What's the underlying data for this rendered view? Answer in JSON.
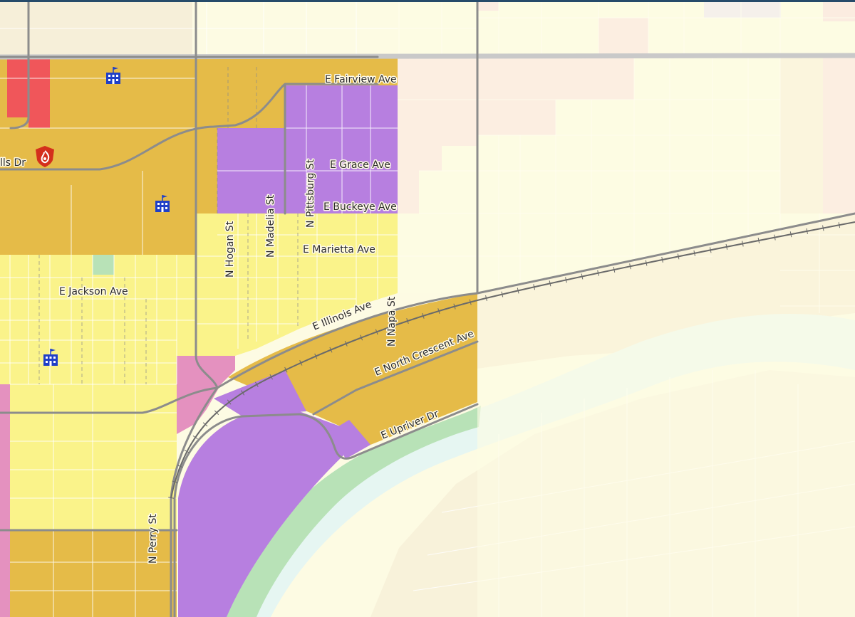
{
  "map": {
    "colors": {
      "background": "#fdfbe3",
      "mixed_use": "#e5bb48",
      "residential_single": "#faf38a",
      "institutional": "#b77fe0",
      "commercial_light": "#f5a6b6",
      "commercial_pink": "#e491bf",
      "commercial_red": "#f0565a",
      "park": "#b8e2b7",
      "river": "#e6f6f2",
      "light_industrial": "#f3e3c3",
      "school_icon": "#1f3fc7",
      "fire_icon": "#d42f1c",
      "top_border": "#264b6a"
    },
    "streets": {
      "fairview": "E Fairview Ave",
      "grace": "E Grace Ave",
      "buckeye": "E Buckeye Ave",
      "marietta": "E Marietta Ave",
      "jackson": "E Jackson Ave",
      "illinois": "E Illinois Ave",
      "north_crescent": "E North Crescent Ave",
      "upriver": "E Upriver Dr",
      "hills": "lls Dr",
      "pittsburg": "N Pittsburg St",
      "madelia": "N Madelia St",
      "hogan": "N Hogan St",
      "napa": "N Napa St",
      "perry": "N Perry St"
    },
    "icons": {
      "school": "school-icon",
      "fire_station": "fire-station-icon"
    }
  }
}
